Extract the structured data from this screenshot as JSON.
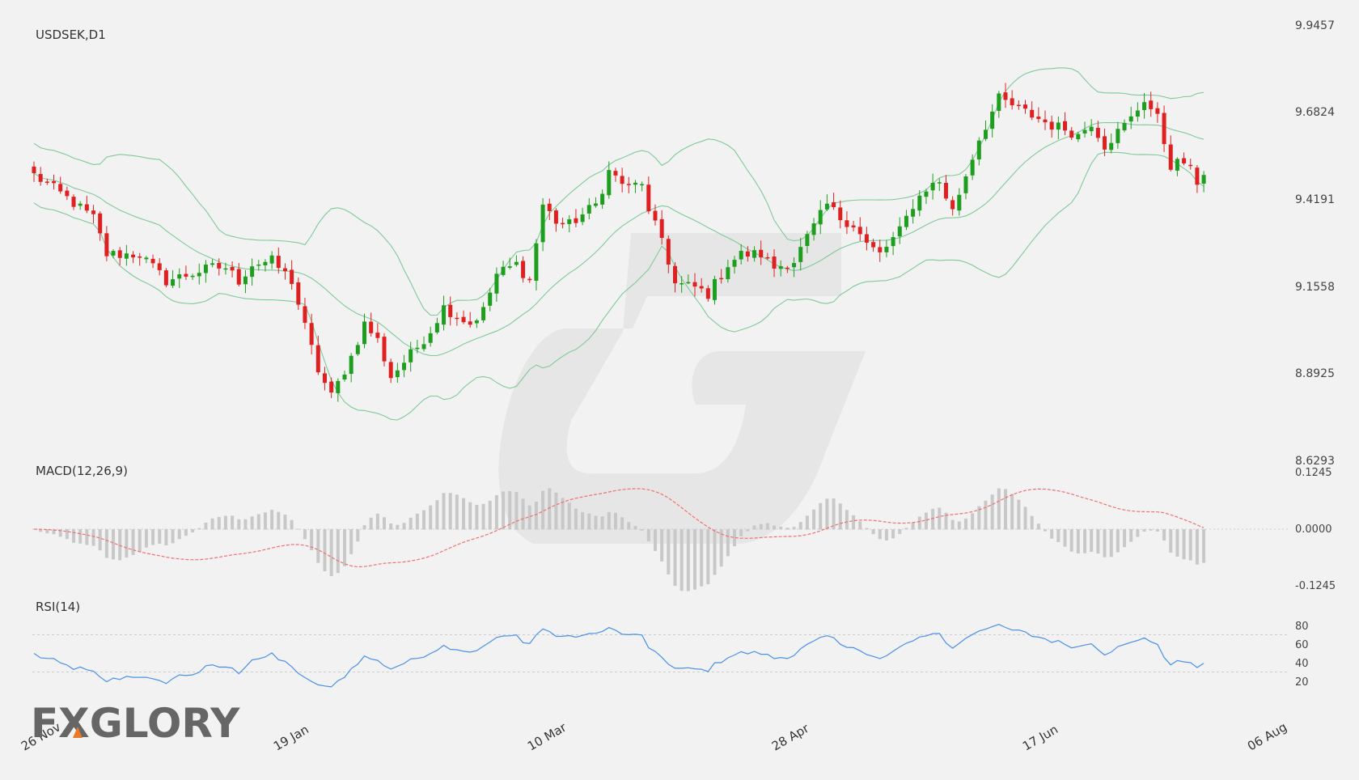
{
  "chart_data": {
    "type": "candlestick",
    "title": "USDSEK,D1",
    "brand": "FXGLORY",
    "colors": {
      "up": "#1e9e1e",
      "down": "#e02020",
      "bands": "#7fc99a",
      "macd_signal": "#f07070",
      "macd_hist": "#c8c8c8",
      "rsi": "#4a90e8",
      "grid": "#c0c0c0"
    },
    "price_axis": {
      "ticks": [
        "9.9457",
        "9.6824",
        "9.4191",
        "9.1558",
        "8.8925",
        "8.6293"
      ],
      "range": [
        8.6293,
        9.9457
      ]
    },
    "date_labels": [
      "26 Nov",
      "19 Jan",
      "10 Mar",
      "28 Apr",
      "17 Jun",
      "06 Aug"
    ],
    "anchors": [
      {
        "i": 0,
        "p": 9.49
      },
      {
        "i": 5,
        "p": 9.42
      },
      {
        "i": 9,
        "p": 9.36
      },
      {
        "i": 11,
        "p": 9.25
      },
      {
        "i": 16,
        "p": 9.25
      },
      {
        "i": 20,
        "p": 9.17
      },
      {
        "i": 27,
        "p": 9.21
      },
      {
        "i": 29,
        "p": 9.21
      },
      {
        "i": 31,
        "p": 9.17
      },
      {
        "i": 33,
        "p": 9.22
      },
      {
        "i": 36,
        "p": 9.23
      },
      {
        "i": 39,
        "p": 9.17
      },
      {
        "i": 41,
        "p": 9.03
      },
      {
        "i": 43,
        "p": 8.9
      },
      {
        "i": 45,
        "p": 8.82
      },
      {
        "i": 48,
        "p": 8.94
      },
      {
        "i": 50,
        "p": 9.04
      },
      {
        "i": 52,
        "p": 8.99
      },
      {
        "i": 54,
        "p": 8.88
      },
      {
        "i": 58,
        "p": 8.97
      },
      {
        "i": 60,
        "p": 9.02
      },
      {
        "i": 62,
        "p": 9.09
      },
      {
        "i": 66,
        "p": 9.04
      },
      {
        "i": 68,
        "p": 9.08
      },
      {
        "i": 70,
        "p": 9.19
      },
      {
        "i": 73,
        "p": 9.22
      },
      {
        "i": 75,
        "p": 9.17
      },
      {
        "i": 77,
        "p": 9.4
      },
      {
        "i": 79,
        "p": 9.35
      },
      {
        "i": 81,
        "p": 9.34
      },
      {
        "i": 85,
        "p": 9.4
      },
      {
        "i": 87,
        "p": 9.5
      },
      {
        "i": 90,
        "p": 9.45
      },
      {
        "i": 92,
        "p": 9.47
      },
      {
        "i": 93,
        "p": 9.37
      },
      {
        "i": 95,
        "p": 9.3
      },
      {
        "i": 97,
        "p": 9.16
      },
      {
        "i": 100,
        "p": 9.15
      },
      {
        "i": 102,
        "p": 9.13
      },
      {
        "i": 105,
        "p": 9.22
      },
      {
        "i": 107,
        "p": 9.25
      },
      {
        "i": 110,
        "p": 9.25
      },
      {
        "i": 112,
        "p": 9.21
      },
      {
        "i": 115,
        "p": 9.23
      },
      {
        "i": 117,
        "p": 9.3
      },
      {
        "i": 120,
        "p": 9.4
      },
      {
        "i": 122,
        "p": 9.36
      },
      {
        "i": 124,
        "p": 9.34
      },
      {
        "i": 126,
        "p": 9.28
      },
      {
        "i": 128,
        "p": 9.25
      },
      {
        "i": 131,
        "p": 9.32
      },
      {
        "i": 133,
        "p": 9.4
      },
      {
        "i": 135,
        "p": 9.45
      },
      {
        "i": 137,
        "p": 9.47
      },
      {
        "i": 139,
        "p": 9.38
      },
      {
        "i": 141,
        "p": 9.49
      },
      {
        "i": 143,
        "p": 9.6
      },
      {
        "i": 145,
        "p": 9.68
      },
      {
        "i": 146,
        "p": 9.72
      },
      {
        "i": 148,
        "p": 9.7
      },
      {
        "i": 150,
        "p": 9.68
      },
      {
        "i": 152,
        "p": 9.66
      },
      {
        "i": 154,
        "p": 9.64
      },
      {
        "i": 156,
        "p": 9.63
      },
      {
        "i": 158,
        "p": 9.61
      },
      {
        "i": 160,
        "p": 9.65
      },
      {
        "i": 162,
        "p": 9.58
      },
      {
        "i": 164,
        "p": 9.62
      },
      {
        "i": 166,
        "p": 9.66
      },
      {
        "i": 168,
        "p": 9.72
      },
      {
        "i": 170,
        "p": 9.66
      },
      {
        "i": 172,
        "p": 9.52
      },
      {
        "i": 174,
        "p": 9.53
      },
      {
        "i": 176,
        "p": 9.47
      },
      {
        "i": 177,
        "p": 9.49
      }
    ],
    "bollinger": {
      "period": 20,
      "stddev": 2,
      "visible": true
    },
    "macd": {
      "title": "MACD(12,26,9)",
      "axis_ticks": [
        "0.1245",
        "0.0000",
        "-0.1245"
      ],
      "range": [
        -0.1245,
        0.1245
      ]
    },
    "rsi": {
      "title": "RSI(14)",
      "axis_ticks": [
        "80",
        "60",
        "40",
        "20"
      ],
      "levels": [
        70,
        30
      ],
      "range": [
        10,
        85
      ]
    }
  }
}
